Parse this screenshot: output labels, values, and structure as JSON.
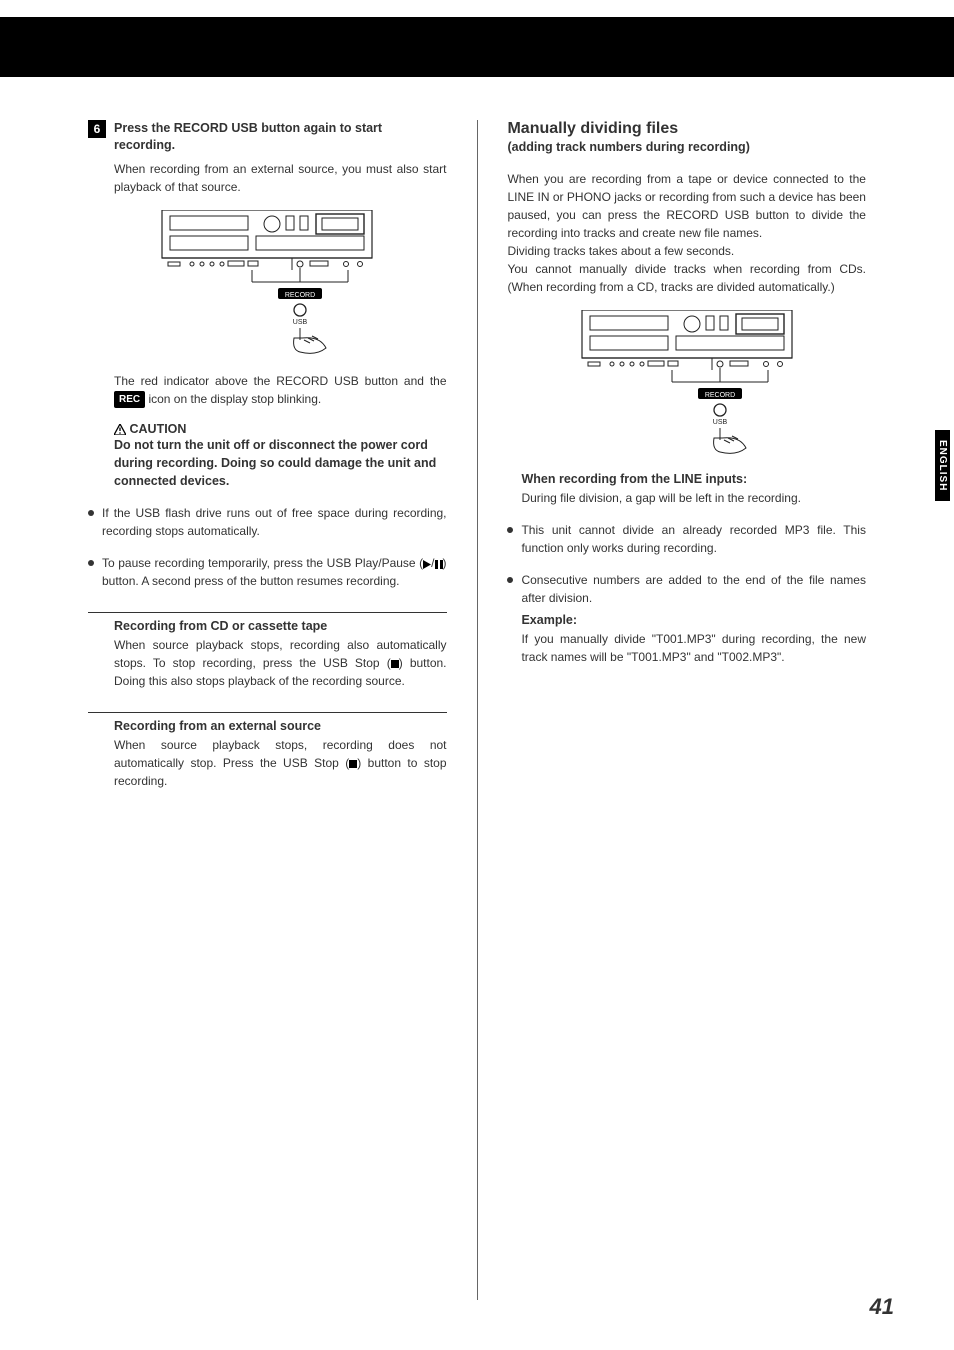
{
  "side_tab": "ENGLISH",
  "page_number": "41",
  "left": {
    "step_num": "6",
    "step_title": "Press the RECORD USB button again to start recording.",
    "step_after": "When recording from an external source, you must also start playback of that source.",
    "diagram_record_label": "RECORD",
    "diagram_usb_label": "USB",
    "red_ind_1": "The red indicator above the RECORD USB button and the ",
    "rec_badge": "REC",
    "red_ind_2": " icon on the display stop blinking.",
    "caution_head": "CAUTION",
    "caution_body": "Do not turn the unit off or disconnect the power cord during recording. Doing so could damage the unit and connected devices.",
    "bullet1": "If the USB flash drive runs out of free space during recording, recording stops automatically.",
    "bullet2_a": "To pause recording temporarily, press the USB Play/Pause (",
    "bullet2_b": ") button. A second press of the button resumes recording.",
    "sub1_head": "Recording from CD or cassette tape",
    "sub1_body_a": "When source playback stops, recording also automatically stops. To stop recording, press the USB Stop (",
    "sub1_body_b": ") button. Doing this also stops playback of the recording source.",
    "sub2_head": "Recording from an external source",
    "sub2_body_a": "When source playback stops, recording does not automatically stop. Press the USB Stop (",
    "sub2_body_b": ") button to stop recording."
  },
  "right": {
    "sect_head": "Manually dividing files",
    "sect_sub": "(adding track numbers during recording)",
    "intro": "When you are recording from a tape or device connected to the LINE IN or PHONO jacks or recording from such a device has been paused, you can press the RECORD USB button to divide the recording into tracks and create new file names.",
    "intro2": "Dividing tracks takes about a few seconds.",
    "intro3": "You cannot manually divide tracks when recording from CDs. (When recording from a CD, tracks are divided automatically.)",
    "diagram_record_label": "RECORD",
    "diagram_usb_label": "USB",
    "line_head": "When recording from the LINE inputs:",
    "line_body": "During file division, a gap will be left in the recording.",
    "bullet1": "This unit cannot divide an already recorded MP3 file. This function only works during recording.",
    "bullet2": "Consecutive numbers are added to the end of the file names after division.",
    "example_head": "Example:",
    "example_body": "If you manually divide \"T001.MP3\" during recording, the new track names will be \"T001.MP3\" and \"T002.MP3\"."
  }
}
